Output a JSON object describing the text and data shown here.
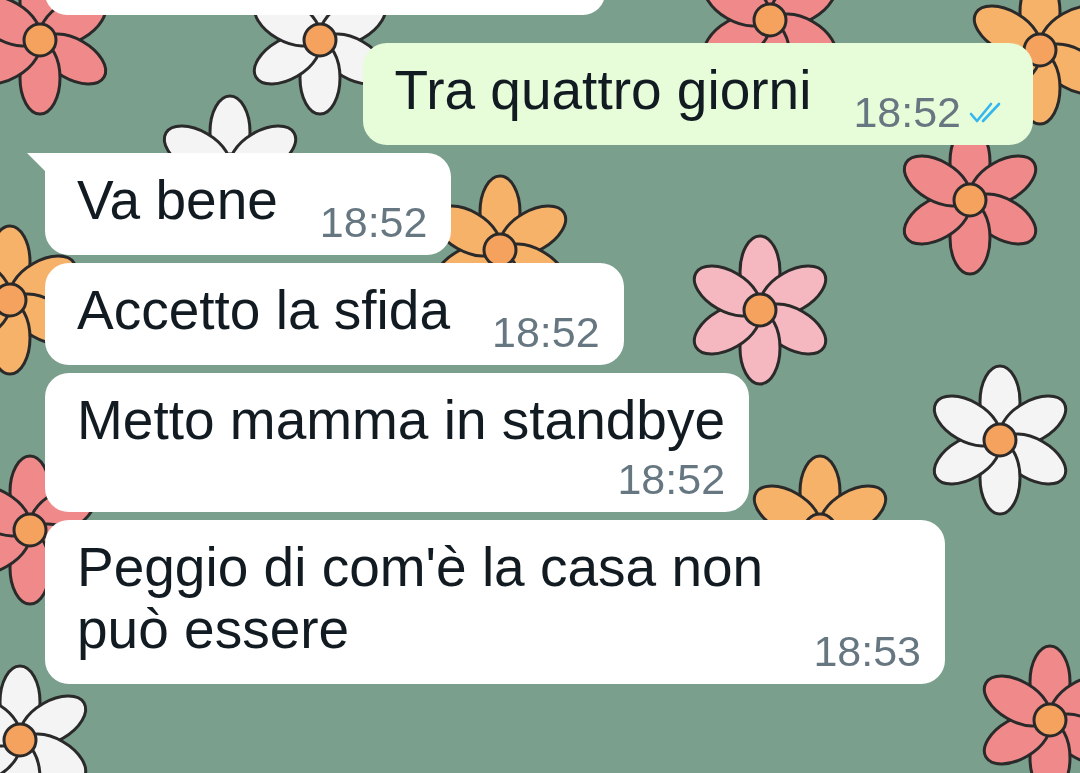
{
  "messages": [
    {
      "outgoing": true,
      "tail": false,
      "text": "Tra quattro giorni",
      "time": "18:52",
      "read": true,
      "time_below": false
    },
    {
      "outgoing": false,
      "tail": true,
      "text": "Va bene",
      "time": "18:52",
      "time_below": false
    },
    {
      "outgoing": false,
      "tail": false,
      "text": "Accetto la sfida",
      "time": "18:52",
      "time_below": false
    },
    {
      "outgoing": false,
      "tail": false,
      "text": "Metto mamma in standbye",
      "time": "18:52",
      "time_below": true
    },
    {
      "outgoing": false,
      "tail": false,
      "text": "Peggio di com'è la casa non può essere",
      "time": "18:53",
      "time_below": false
    }
  ]
}
